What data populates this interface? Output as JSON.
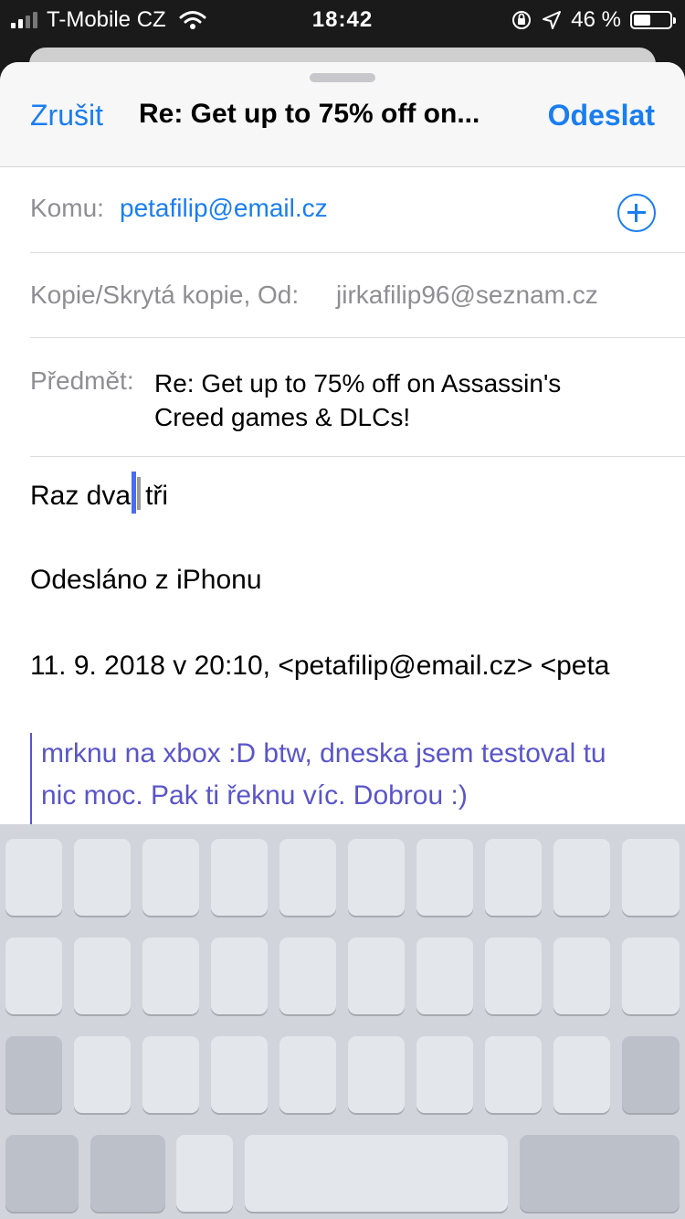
{
  "status_bar": {
    "carrier": "T-Mobile CZ",
    "time": "18:42",
    "battery_percent": "46 %",
    "battery_level": 0.46,
    "icons": [
      "signal-icon",
      "wifi-icon",
      "orientation-lock-icon",
      "location-icon",
      "battery-icon"
    ]
  },
  "compose": {
    "cancel_label": "Zrušit",
    "title": "Re: Get up to 75% off on...",
    "send_label": "Odeslat",
    "accent_color": "#1a7ef0",
    "to_label": "Komu:",
    "to_value": "petafilip@email.cz",
    "cc_label": "Kopie/Skrytá kopie, Od:",
    "from_value": "jirkafilip96@seznam.cz",
    "subject_label": "Předmět:",
    "subject_value": "Re: Get up to 75% off on Assassin's Creed games & DLCs!"
  },
  "body": {
    "text_before_cursor": "Raz dva",
    "text_after_cursor": "tři",
    "signature": "Odesláno z iPhonu",
    "reply_header": "11. 9. 2018 v 20:10, <petafilip@email.cz> <peta",
    "quote_line1": "mrknu na xbox :D btw, dneska jsem testoval tu",
    "quote_line2": "nic moc. Pak ti řeknu víc. Dobrou :)",
    "quote_color": "#5a55c9"
  }
}
